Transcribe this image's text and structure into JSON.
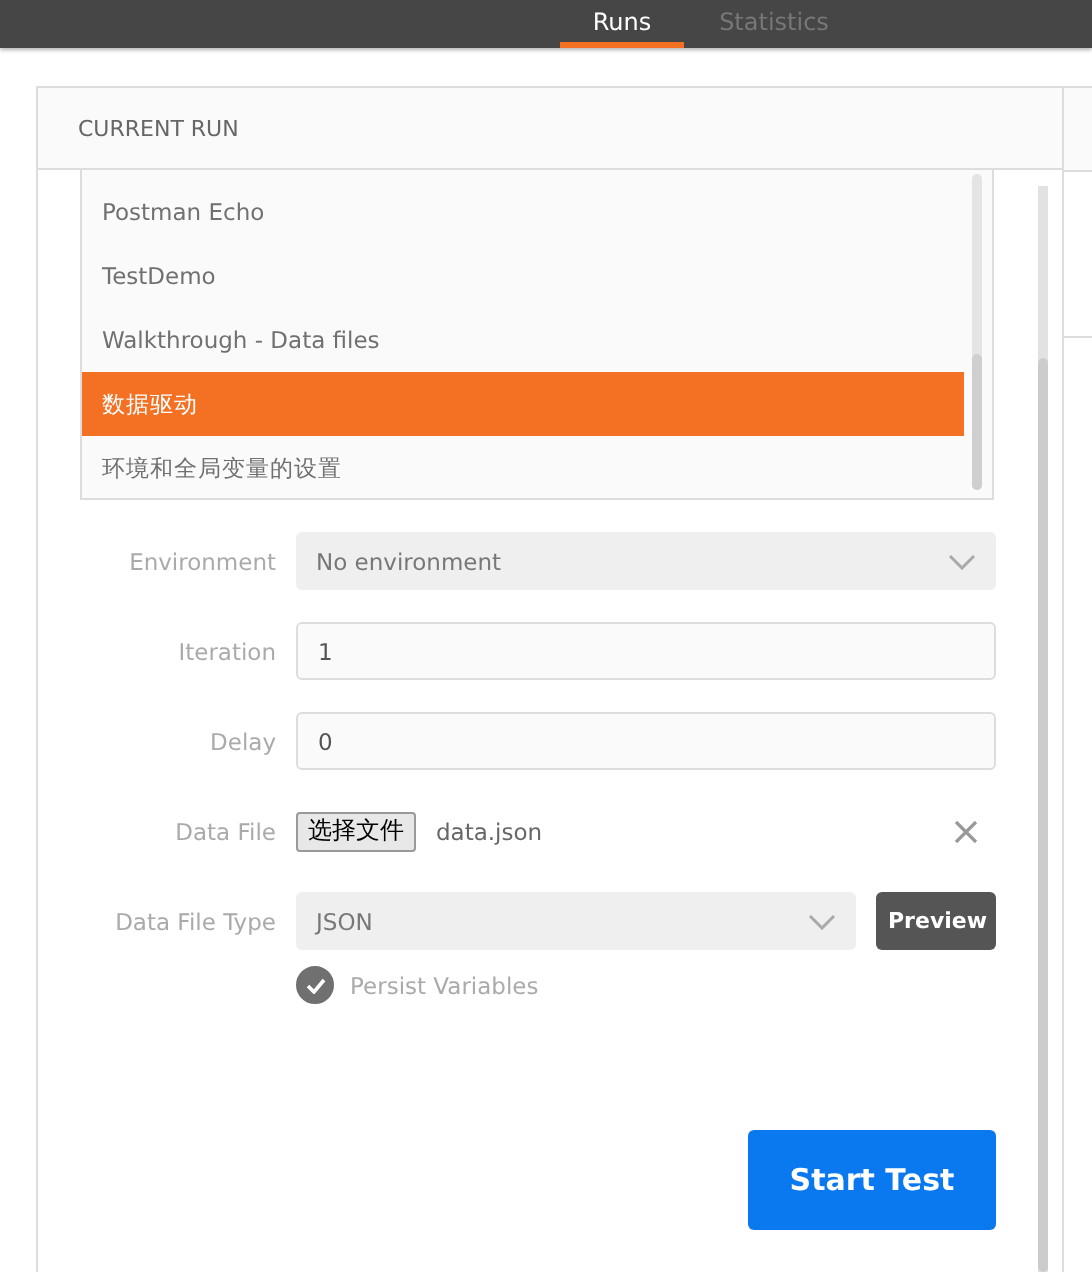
{
  "tabs": [
    {
      "label": "Runs",
      "selected": true
    },
    {
      "label": "Statistics",
      "selected": false
    }
  ],
  "panel": {
    "title": "CURRENT RUN"
  },
  "collections": [
    {
      "label": "Postman Echo",
      "selected": false
    },
    {
      "label": "TestDemo",
      "selected": false
    },
    {
      "label": "Walkthrough - Data files",
      "selected": false
    },
    {
      "label": "数据驱动",
      "selected": true
    },
    {
      "label": "环境和全局变量的设置",
      "selected": false
    }
  ],
  "environment": {
    "label": "Environment",
    "value": "No environment"
  },
  "iteration": {
    "label": "Iteration",
    "value": "1"
  },
  "delay": {
    "label": "Delay",
    "value": "0"
  },
  "data_file": {
    "label": "Data File",
    "button": "选择文件",
    "file_name": "data.json"
  },
  "data_file_type": {
    "label": "Data File Type",
    "value": "JSON",
    "preview": "Preview"
  },
  "persist_variables": {
    "label": "Persist Variables",
    "checked": true
  },
  "start_button": "Start Test"
}
